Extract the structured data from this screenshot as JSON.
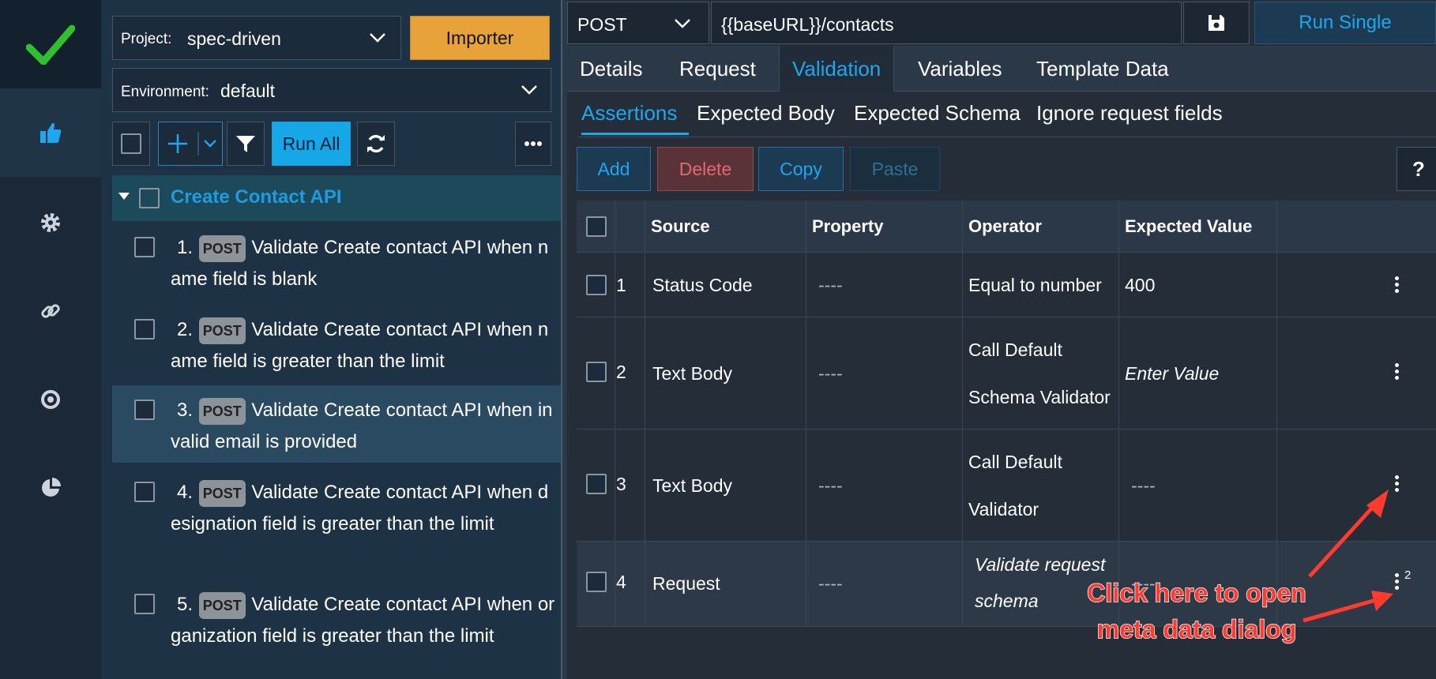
{
  "project": {
    "label": "Project:",
    "value": "spec-driven",
    "importer_label": "Importer"
  },
  "environment": {
    "label": "Environment:",
    "value": "default"
  },
  "toolbar": {
    "run_all_label": "Run All"
  },
  "group": {
    "title": "Create Contact API"
  },
  "tests": [
    {
      "num": "1.",
      "method": "POST",
      "text": "Validate Create contact API when name field is blank"
    },
    {
      "num": "2.",
      "method": "POST",
      "text": "Validate Create contact API when name field is greater than the limit"
    },
    {
      "num": "3.",
      "method": "POST",
      "text": "Validate Create contact API when invalid email is provided"
    },
    {
      "num": "4.",
      "method": "POST",
      "text": "Validate Create contact API when designation field is greater than the limit"
    },
    {
      "num": "5.",
      "method": "POST",
      "text": "Validate Create contact API when organization field is greater than the limit"
    }
  ],
  "request": {
    "method": "POST",
    "url": "{{baseURL}}/contacts",
    "run_single_label": "Run Single"
  },
  "tabs": [
    "Details",
    "Request",
    "Validation",
    "Variables",
    "Template Data"
  ],
  "subtabs": [
    "Assertions",
    "Expected Body",
    "Expected Schema",
    "Ignore request fields"
  ],
  "actions": {
    "add": "Add",
    "delete": "Delete",
    "copy": "Copy",
    "paste": "Paste",
    "help": "?"
  },
  "table": {
    "headers": [
      "Source",
      "Property",
      "Operator",
      "Expected Value"
    ],
    "rows": [
      {
        "num": "1",
        "source": "Status Code",
        "property": "----",
        "operator_line1": "Equal to number",
        "operator_line2": "",
        "expected": "400"
      },
      {
        "num": "2",
        "source": "Text Body",
        "property": "----",
        "operator_line1": "Call Default",
        "operator_line2": "Schema Validator",
        "expected": "Enter Value"
      },
      {
        "num": "3",
        "source": "Text Body",
        "property": "----",
        "operator_line1": "Call Default",
        "operator_line2": "Validator",
        "expected": "----"
      },
      {
        "num": "4",
        "source": "Request",
        "property": "----",
        "operator_line1": "Validate request",
        "operator_line2": "schema",
        "expected": "----",
        "meta_count": "2"
      }
    ]
  },
  "annotation": {
    "line1": "Click here to open",
    "line2": "meta data dialog"
  },
  "colors": {
    "accent": "#1ea6ee",
    "importer": "#e8a23a",
    "danger": "#e4696f",
    "check": "#2fbf2f",
    "annotation": "#ff3b2f"
  },
  "icons": [
    "checkmark-logo-icon",
    "thumbs-up-icon",
    "gear-icon",
    "link-icon",
    "target-icon",
    "pie-chart-icon",
    "filter-icon",
    "refresh-icon",
    "save-icon",
    "more-icon",
    "kebab-icon"
  ]
}
